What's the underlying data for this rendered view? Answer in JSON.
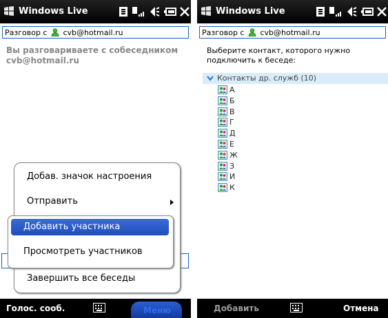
{
  "left": {
    "title": "Windows Live",
    "conversation_prefix": "Разговор с",
    "conversation_email": "cvb@hotmail.ru",
    "message": "Вы разговариваете с собеседником cvb@hotmail.ru",
    "menu": {
      "items": [
        {
          "label": "Добав. значок настроения"
        },
        {
          "label": "Отправить",
          "has_submenu": true
        }
      ],
      "submenu_items": [
        {
          "label": "Добавить участника",
          "selected": true
        },
        {
          "label": "Просмотреть участников"
        }
      ],
      "last_item": "Завершить все беседы"
    },
    "softkeys": {
      "left": "Голос. сооб.",
      "right": "Меню"
    }
  },
  "right": {
    "title": "Windows Live",
    "conversation_prefix": "Разговор с",
    "conversation_email": "cvb@hotmail.ru",
    "prompt": "Выберите контакт, которого нужно подключить к беседе:",
    "group_label": "Контакты др. служб (10)",
    "contacts": [
      "А",
      "Б",
      "В",
      "Г",
      "Д",
      "Е",
      "Ж",
      "З",
      "И",
      "К"
    ],
    "softkeys": {
      "left": "Добавить",
      "right": "Отмена"
    }
  },
  "colors": {
    "accent": "#1f4dbd",
    "group_background": "#d8ecfa",
    "titlebar": "#000000",
    "muted_text": "#888888"
  },
  "icons": [
    "windows-flag-icon",
    "data-connection-icon",
    "signal-icon",
    "speaker-icon",
    "battery-icon",
    "close-icon",
    "buddy-icon",
    "keyboard-icon",
    "chevron-down-icon",
    "contact-icon"
  ]
}
